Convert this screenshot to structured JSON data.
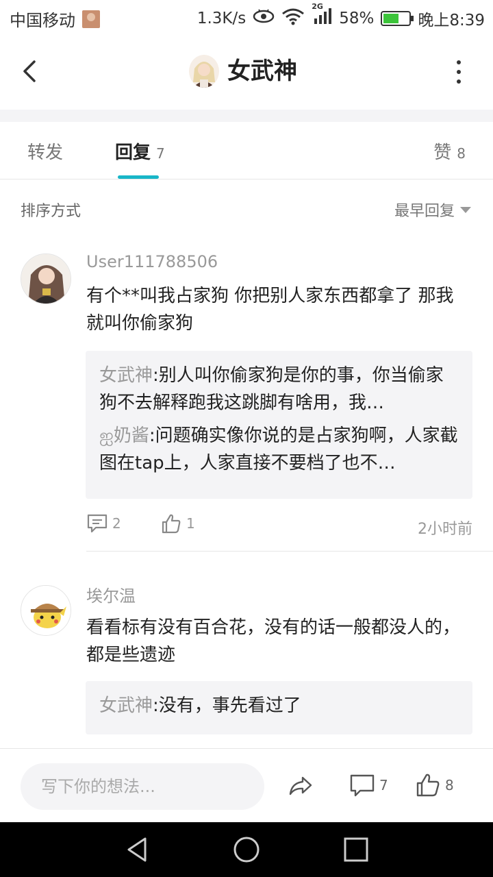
{
  "status_bar": {
    "carrier": "中国移动",
    "speed": "1.3K/s",
    "network": "2G",
    "battery": "58%",
    "battery_level": 0.58,
    "time": "晚上8:39"
  },
  "header": {
    "title": "女武神"
  },
  "tabs": {
    "forward": {
      "label": "转发"
    },
    "reply": {
      "label": "回复",
      "count": "7"
    },
    "like": {
      "label": "赞",
      "count": "8"
    }
  },
  "sort": {
    "label": "排序方式",
    "selected": "最早回复"
  },
  "comments": [
    {
      "username": "User111788506",
      "text": "有个**叫我占家狗 你把别人家东西都拿了 那我就叫你偷家狗",
      "replies": [
        {
          "name": "女武神",
          "text": "别人叫你偷家狗是你的事，你当偷家狗不去解释跑我这跳脚有啥用，我…"
        },
        {
          "name": "ஐ奶酱",
          "text": "问题确实像你说的是占家狗啊，人家截图在tap上，人家直接不要档了也不…"
        }
      ],
      "reply_count": "2",
      "like_count": "1",
      "time": "2小时前"
    },
    {
      "username": "埃尔温",
      "text": "看看标有没有百合花，没有的话一般都没人的，都是些遗迹",
      "replies": [
        {
          "name": "女武神",
          "text": "没有，事先看过了"
        }
      ]
    }
  ],
  "composer": {
    "placeholder": "写下你的想法...",
    "comment_count": "7",
    "like_count": "8"
  }
}
